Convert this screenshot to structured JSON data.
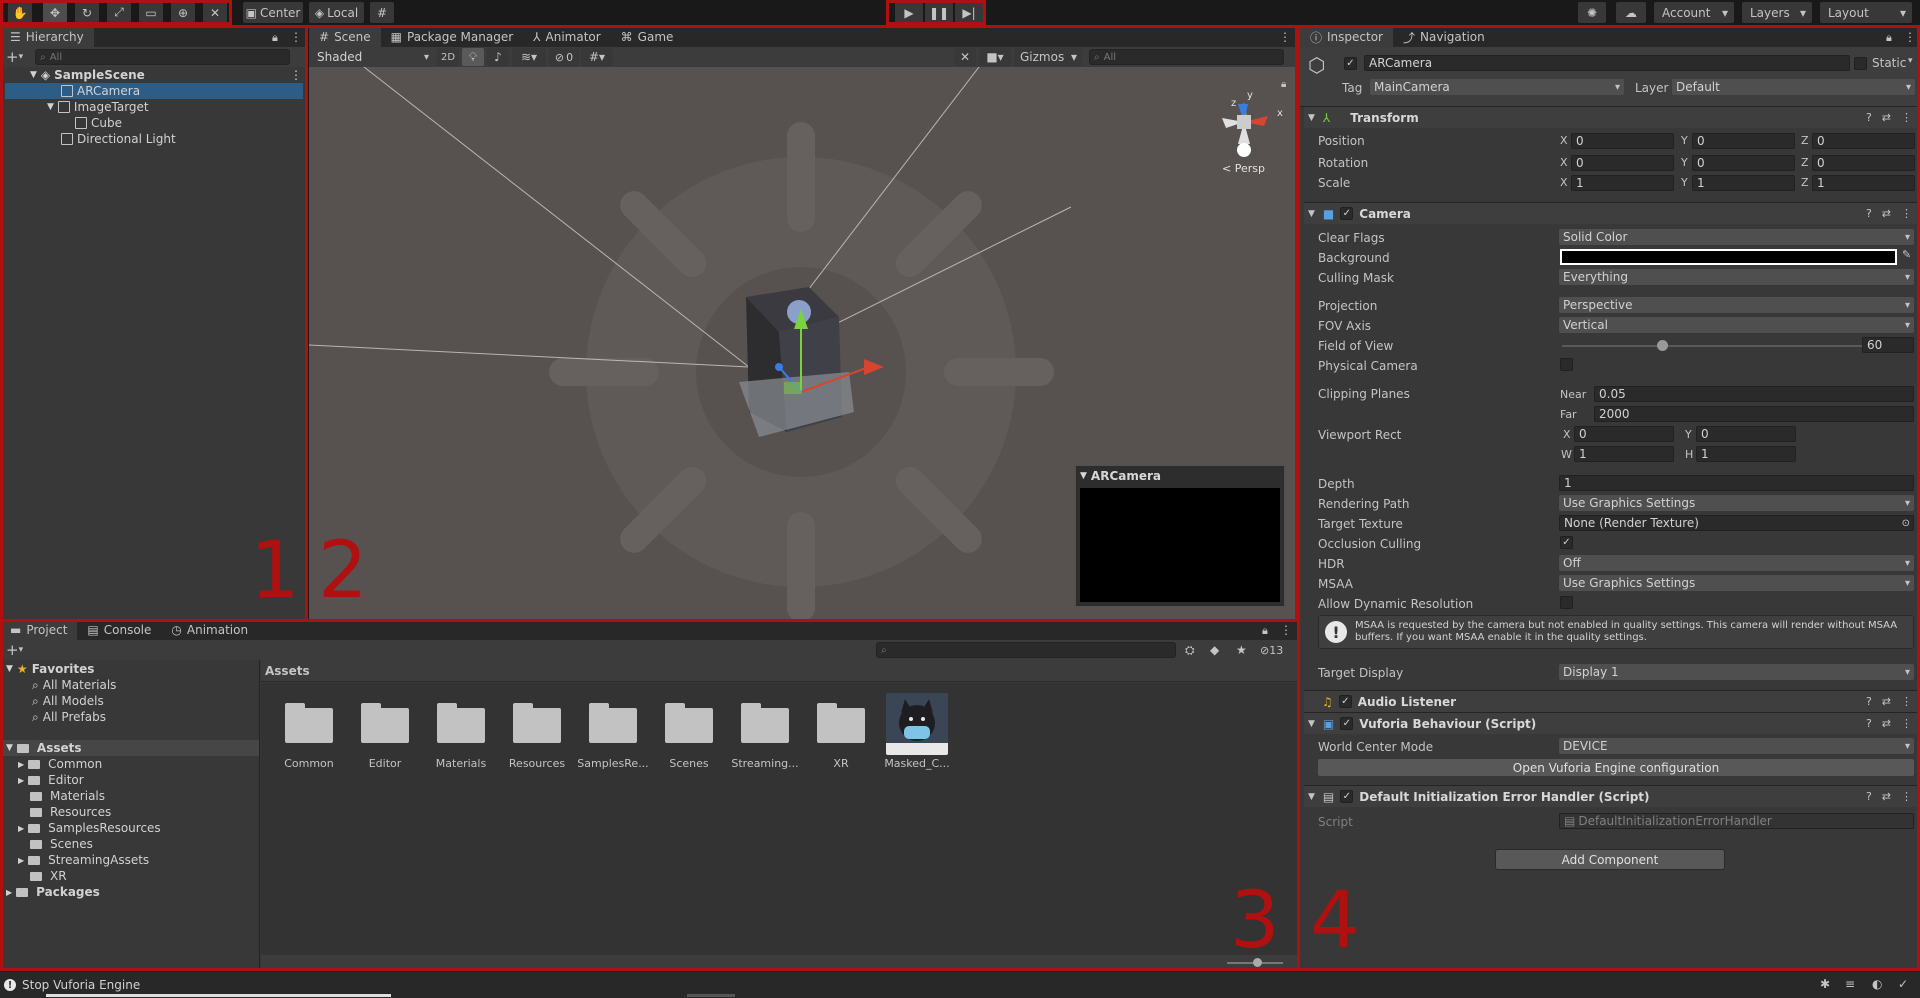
{
  "toolbar": {
    "tools": [
      "hand-tool",
      "move-tool",
      "rotate-tool",
      "scale-tool",
      "rect-tool",
      "transform-tool",
      "custom-tool"
    ],
    "pivot": "Center",
    "space": "Local",
    "account": "Account",
    "layers": "Layers",
    "layout": "Layout"
  },
  "hierarchy": {
    "tab": "Hierarchy",
    "search_placeholder": "All",
    "scene": "SampleScene",
    "items": [
      {
        "label": "ARCamera",
        "selected": true
      },
      {
        "label": "ImageTarget"
      },
      {
        "label": "Cube"
      },
      {
        "label": "Directional Light"
      }
    ]
  },
  "scene_view": {
    "tabs": [
      "Scene",
      "Package Manager",
      "Animator",
      "Game"
    ],
    "shading": "Shaded",
    "mode_2d": "2D",
    "hidden_count": "0",
    "gizmos": "Gizmos",
    "search_placeholder": "All",
    "persp": "Persp",
    "gizmo_axes": {
      "x": "x",
      "y": "y",
      "z": "z"
    },
    "camera_preview_title": "ARCamera"
  },
  "project": {
    "tabs": [
      "Project",
      "Console",
      "Animation"
    ],
    "favorites_label": "Favorites",
    "favorites": [
      "All Materials",
      "All Models",
      "All Prefabs"
    ],
    "assets_label": "Assets",
    "asset_folders": [
      "Common",
      "Editor",
      "Materials",
      "Resources",
      "SamplesResources",
      "Scenes",
      "StreamingAssets",
      "XR"
    ],
    "packages_label": "Packages",
    "breadcrumb": "Assets",
    "hidden_count": "13",
    "grid_items": [
      "Common",
      "Editor",
      "Materials",
      "Resources",
      "SamplesRe...",
      "Scenes",
      "Streaming...",
      "XR",
      "Masked_C..."
    ]
  },
  "inspector": {
    "tabs": [
      "Inspector",
      "Navigation"
    ],
    "object_name": "ARCamera",
    "static_label": "Static",
    "tag_label": "Tag",
    "tag_value": "MainCamera",
    "layer_label": "Layer",
    "layer_value": "Default",
    "transform": {
      "title": "Transform",
      "position": {
        "label": "Position",
        "x": "0",
        "y": "0",
        "z": "0"
      },
      "rotation": {
        "label": "Rotation",
        "x": "0",
        "y": "0",
        "z": "0"
      },
      "scale": {
        "label": "Scale",
        "x": "1",
        "y": "1",
        "z": "1"
      }
    },
    "camera": {
      "title": "Camera",
      "clear_flags": {
        "label": "Clear Flags",
        "value": "Solid Color"
      },
      "background": {
        "label": "Background"
      },
      "culling_mask": {
        "label": "Culling Mask",
        "value": "Everything"
      },
      "projection": {
        "label": "Projection",
        "value": "Perspective"
      },
      "fov_axis": {
        "label": "FOV Axis",
        "value": "Vertical"
      },
      "field_of_view": {
        "label": "Field of View",
        "value": "60"
      },
      "physical_camera": {
        "label": "Physical Camera"
      },
      "clipping": {
        "label": "Clipping Planes",
        "near_label": "Near",
        "near": "0.05",
        "far_label": "Far",
        "far": "2000"
      },
      "viewport": {
        "label": "Viewport Rect",
        "x": "0",
        "y": "0",
        "w": "1",
        "h": "1"
      },
      "depth": {
        "label": "Depth",
        "value": "1"
      },
      "rendering_path": {
        "label": "Rendering Path",
        "value": "Use Graphics Settings"
      },
      "target_texture": {
        "label": "Target Texture",
        "value": "None (Render Texture)"
      },
      "occlusion_culling": {
        "label": "Occlusion Culling"
      },
      "hdr": {
        "label": "HDR",
        "value": "Off"
      },
      "msaa": {
        "label": "MSAA",
        "value": "Use Graphics Settings"
      },
      "dynamic_resolution": {
        "label": "Allow Dynamic Resolution"
      },
      "warning": "MSAA is requested by the camera but not enabled in quality settings. This camera will render without MSAA buffers. If you want MSAA enable it in the quality settings.",
      "target_display": {
        "label": "Target Display",
        "value": "Display 1"
      }
    },
    "audio_listener": {
      "title": "Audio Listener"
    },
    "vuforia": {
      "title": "Vuforia Behaviour (Script)",
      "world_center": {
        "label": "World Center Mode",
        "value": "DEVICE"
      },
      "open_config": "Open Vuforia Engine configuration"
    },
    "error_handler": {
      "title": "Default Initialization Error Handler (Script)",
      "script_label": "Script",
      "script_value": "DefaultInitializationErrorHandler"
    },
    "add_component": "Add Component"
  },
  "annotations": {
    "n1": "1",
    "n2": "2",
    "n3": "3",
    "n4": "4"
  },
  "status_bar": {
    "message": "Stop Vuforia Engine"
  },
  "colors": {
    "accent": "#2c5d87",
    "highlight_box": "#b01010"
  }
}
